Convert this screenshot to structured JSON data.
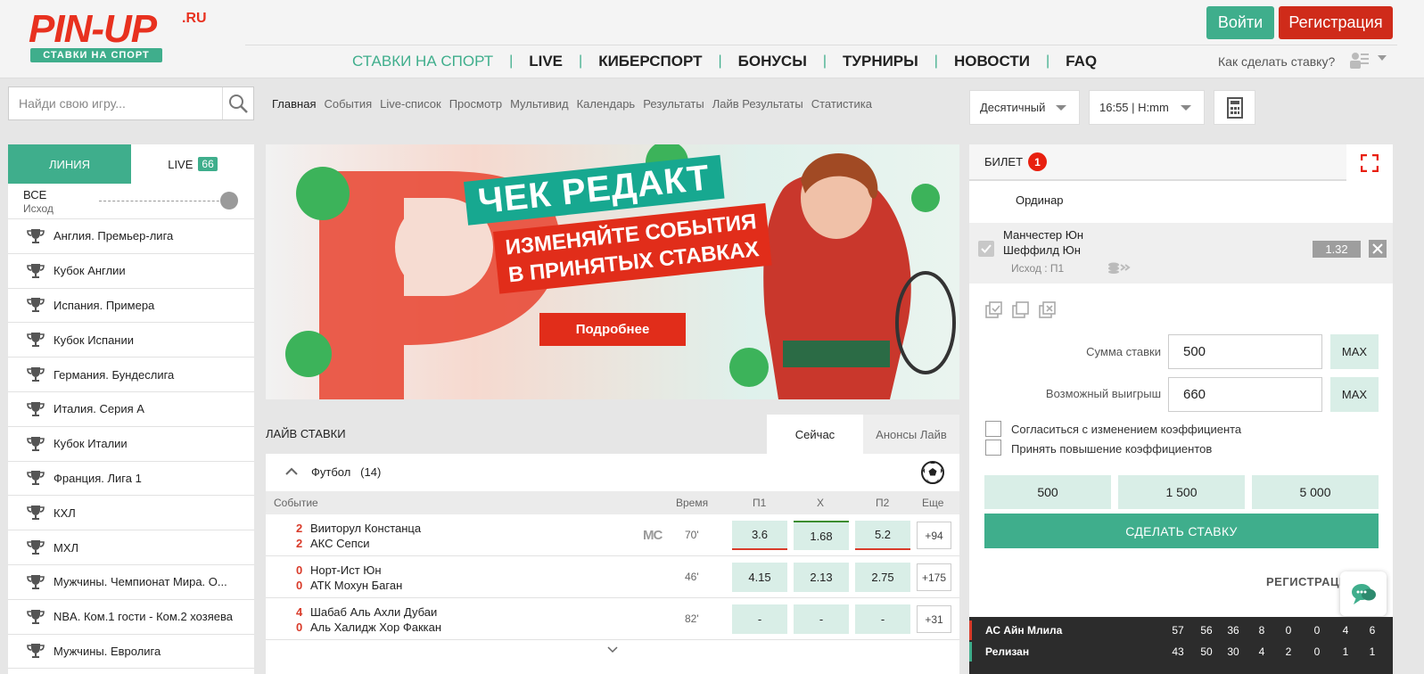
{
  "header": {
    "logo": "PIN-UP",
    "logo_ru": ".RU",
    "logo_sub": "СТАВКИ НА СПОРТ",
    "nav": [
      "СТАВКИ НА СПОРТ",
      "LIVE",
      "КИБЕРСПОРТ",
      "БОНУСЫ",
      "ТУРНИРЫ",
      "НОВОСТИ",
      "FAQ"
    ],
    "login": "Войти",
    "register": "Регистрация",
    "howto": "Как сделать ставку?"
  },
  "search": {
    "placeholder": "Найди свою игру..."
  },
  "subnav": [
    "Главная",
    "События",
    "Live-список",
    "Просмотр",
    "Мультивид",
    "Календарь",
    "Результаты",
    "Лайв Результаты",
    "Статистика"
  ],
  "selects": {
    "odds_format": "Десятичный",
    "time_format": "16:55 | H:mm"
  },
  "sidebar": {
    "tab_line": "ЛИНИЯ",
    "tab_live": "LIVE",
    "live_count": "66",
    "filter_all": "ВСЕ",
    "filter_outcome": "Исход",
    "leagues": [
      "Англия. Премьер-лига",
      "Кубок Англии",
      "Испания. Примера",
      "Кубок Испании",
      "Германия. Бундеслига",
      "Италия. Серия А",
      "Кубок Италии",
      "Франция. Лига 1",
      "КХЛ",
      "МХЛ",
      "Мужчины. Чемпионат Мира. О...",
      "NBA. Ком.1 гости - Ком.2 хозяева",
      "Мужчины. Евролига"
    ]
  },
  "banner": {
    "title": "ЧЕК РЕДАКТ",
    "subtitle_1": "ИЗМЕНЯЙТЕ СОБЫТИЯ",
    "subtitle_2": "В ПРИНЯТЫХ СТАВКАХ",
    "button": "Подробнее"
  },
  "live": {
    "title": "ЛАЙВ СТАВКИ",
    "tab_now": "Сейчас",
    "tab_announce": "Анонсы Лайв",
    "sport": "Футбол",
    "sport_count": "(14)",
    "columns": {
      "event": "Событие",
      "time": "Время",
      "p1": "П1",
      "x": "Х",
      "p2": "П2",
      "more": "Еще"
    },
    "matches": [
      {
        "s1": "2",
        "team1": "Вииторул Констанца",
        "s2": "2",
        "team2": "АКС Сепси",
        "badge": "MC",
        "time": "70'",
        "p1": "3.6",
        "x": "1.68",
        "p2": "5.2",
        "more": "+94"
      },
      {
        "s1": "0",
        "team1": "Норт-Ист Юн",
        "s2": "0",
        "team2": "АТК Мохун Баган",
        "badge": "",
        "time": "46'",
        "p1": "4.15",
        "x": "2.13",
        "p2": "2.75",
        "more": "+175"
      },
      {
        "s1": "4",
        "team1": "Шабаб Аль Ахли Дубаи",
        "s2": "0",
        "team2": "Аль Халидж Хор Факкан",
        "badge": "",
        "time": "82'",
        "p1": "-",
        "x": "-",
        "p2": "-",
        "more": "+31"
      }
    ]
  },
  "ticket": {
    "title": "БИЛЕТ",
    "count": "1",
    "type": "Ординар",
    "team1": "Манчестер Юн",
    "team2": "Шеффилд Юн",
    "outcome": "Исход : П1",
    "odd": "1.32",
    "stake_label": "Сумма ставки",
    "stake_value": "500",
    "win_label": "Возможный выигрыш",
    "win_value": "660",
    "max": "MAX",
    "agree_change": "Согласиться с изменением коэффициента",
    "accept_raise": "Принять повышение коэффициентов",
    "quick": [
      "500",
      "1 500",
      "5 000"
    ],
    "make_bet": "СДЕЛАТЬ СТАВКУ",
    "register": "РЕГИСТРАЦИЯ"
  },
  "scoreboard": {
    "rows": [
      {
        "team": "АС Айн Млила",
        "vals": [
          "57",
          "56",
          "36",
          "8",
          "0",
          "0",
          "4",
          "6"
        ]
      },
      {
        "team": "Релизан",
        "vals": [
          "43",
          "50",
          "30",
          "4",
          "2",
          "0",
          "1",
          "1"
        ]
      }
    ]
  },
  "colors": {
    "accent": "#3fae8c",
    "brand_red": "#cf2b1a",
    "odd_bg": "#d9eee7"
  }
}
